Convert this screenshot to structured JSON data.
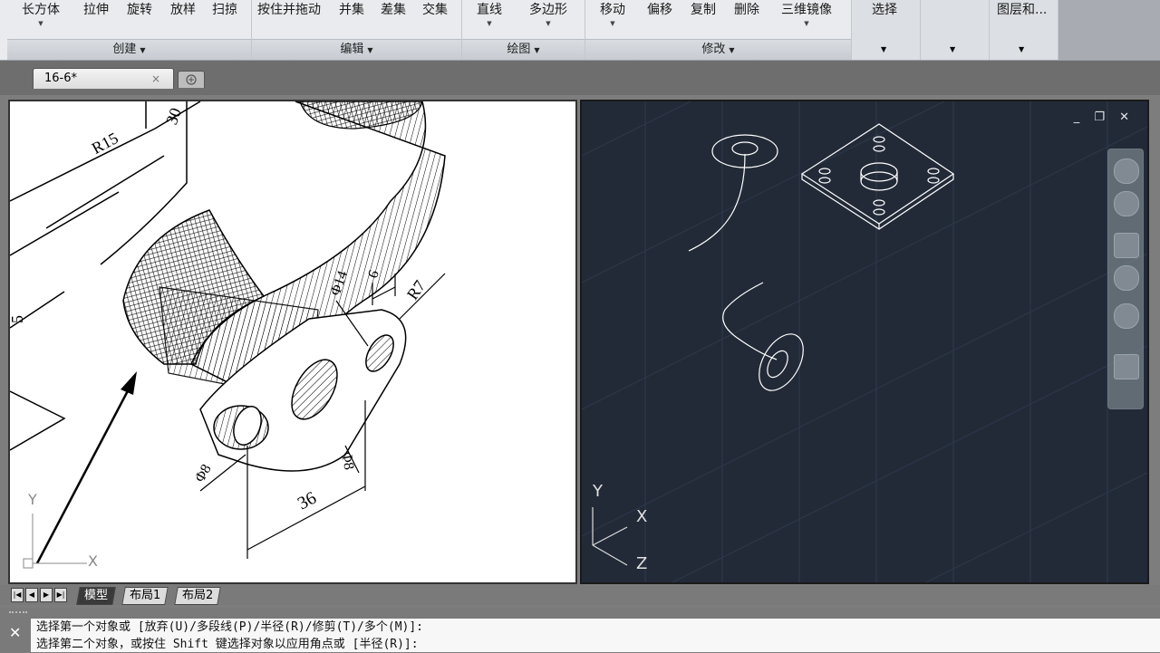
{
  "ribbon": {
    "groups": [
      {
        "name": "create",
        "label": "创建",
        "tools": [
          "长方体",
          "拉伸",
          "旋转",
          "放样",
          "扫掠"
        ]
      },
      {
        "name": "edit",
        "label": "编辑",
        "tools": [
          "按住并拖动",
          "并集",
          "差集",
          "交集"
        ]
      },
      {
        "name": "draw",
        "label": "绘图",
        "tools": [
          "直线",
          "多边形"
        ]
      },
      {
        "name": "modify",
        "label": "修改",
        "tools": [
          "移动",
          "偏移",
          "复制",
          "删除",
          "三维镜像"
        ]
      }
    ],
    "select_label": "选择",
    "layers_label": "图层和..."
  },
  "tabs": {
    "document": "16-6*",
    "close_symbol": "×"
  },
  "drawing_left": {
    "dims": [
      "R15",
      "30",
      "5",
      "R7",
      "Φ14",
      "6",
      "Φ8",
      "Φ8",
      "36"
    ],
    "ucs_y": "Y",
    "ucs_x": "X"
  },
  "drawing_right": {
    "viewport_controls": "_ ❐ ✕",
    "ucs": {
      "y": "Y",
      "x": "X",
      "z": "Z"
    }
  },
  "layout_tabs": [
    "模型",
    "布局1",
    "布局2"
  ],
  "command": {
    "lines": [
      "选择第一个对象或 [放弃(U)/多段线(P)/半径(R)/修剪(T)/多个(M)]:",
      "选择第二个对象，或按住 Shift 键选择对象以应用角点或 [半径(R)]:"
    ]
  },
  "colors": {
    "model_bg": "#222a38",
    "accent": "#d9dde2"
  }
}
